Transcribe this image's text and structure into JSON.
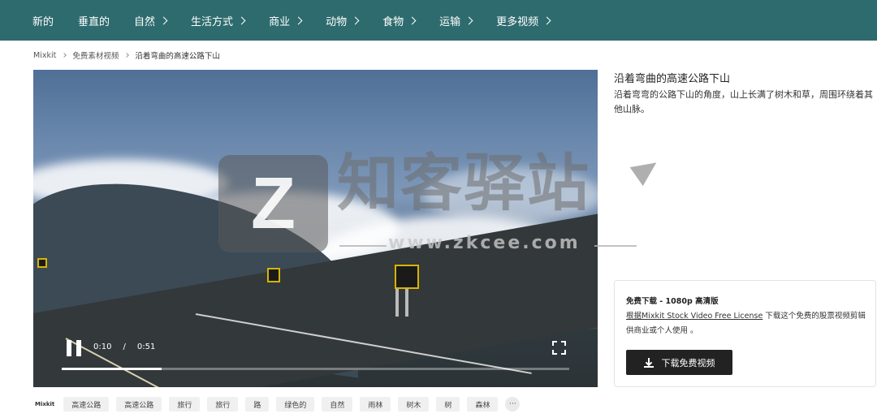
{
  "nav": {
    "items": [
      {
        "label": "新的",
        "has_chevron": false
      },
      {
        "label": "垂直的",
        "has_chevron": false
      },
      {
        "label": "自然",
        "has_chevron": true
      },
      {
        "label": "生活方式",
        "has_chevron": true
      },
      {
        "label": "商业",
        "has_chevron": true
      },
      {
        "label": "动物",
        "has_chevron": true
      },
      {
        "label": "食物",
        "has_chevron": true
      },
      {
        "label": "运输",
        "has_chevron": true
      },
      {
        "label": "更多视频",
        "has_chevron": true
      }
    ],
    "bg_color": "#2e6b6e"
  },
  "breadcrumb": [
    "Mixkit",
    "免费素材视频",
    "沿着弯曲的高速公路下山"
  ],
  "video": {
    "current_time": "0:10",
    "time_separator": "/",
    "duration": "0:51",
    "progress_fraction": 0.196,
    "play_state": "pause-icon"
  },
  "watermark": {
    "logo_letter": "Z",
    "text": "知客驿站",
    "url": "www.zkcee.com"
  },
  "details": {
    "title": "沿着弯曲的高速公路下山",
    "description": "沿着弯弯的公路下山的角度，山上长满了树木和草，周围环绕着其他山脉。"
  },
  "download": {
    "heading": "免费下载 - 1080p 高清版",
    "license_link": "根据Mixkit Stock Video Free License",
    "license_rest": " 下载这个免费的股票视频剪辑供商业或个人使用 。",
    "button_label": "下载免费视频"
  },
  "tags": {
    "logo": "Mixkit",
    "items": [
      "高速公路",
      "高速公路",
      "旅行",
      "旅行",
      "路",
      "绿色的",
      "自然",
      "雨林",
      "树木",
      "树",
      "森林"
    ],
    "more_label": "···"
  }
}
